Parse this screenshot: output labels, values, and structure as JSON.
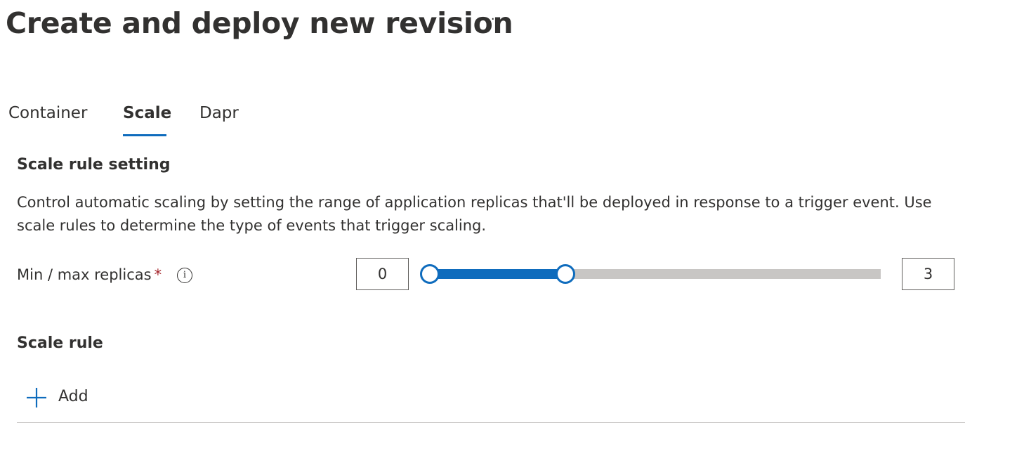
{
  "header": {
    "title": "Create and deploy new revision",
    "more_label": "···"
  },
  "tabs": [
    {
      "label": "Container",
      "active": false
    },
    {
      "label": "Scale",
      "active": true
    },
    {
      "label": "Dapr",
      "active": false
    }
  ],
  "scale_rule_setting": {
    "heading": "Scale rule setting",
    "description": "Control automatic scaling by setting the range of application replicas that'll be deployed in response to a trigger event. Use scale rules to determine the type of events that trigger scaling.",
    "replicas": {
      "label": "Min / max replicas",
      "required_marker": "*",
      "info_icon": "info-icon",
      "min_value": "0",
      "max_value": "3",
      "slider_low_fraction": 0,
      "slider_high_fraction": 0.3
    }
  },
  "scale_rule": {
    "heading": "Scale rule",
    "add_label": "Add",
    "add_icon": "plus-icon"
  },
  "colors": {
    "accent": "#0f6cbd",
    "rail": "#c8c6c4",
    "text": "#323130",
    "required": "#a4262c"
  }
}
